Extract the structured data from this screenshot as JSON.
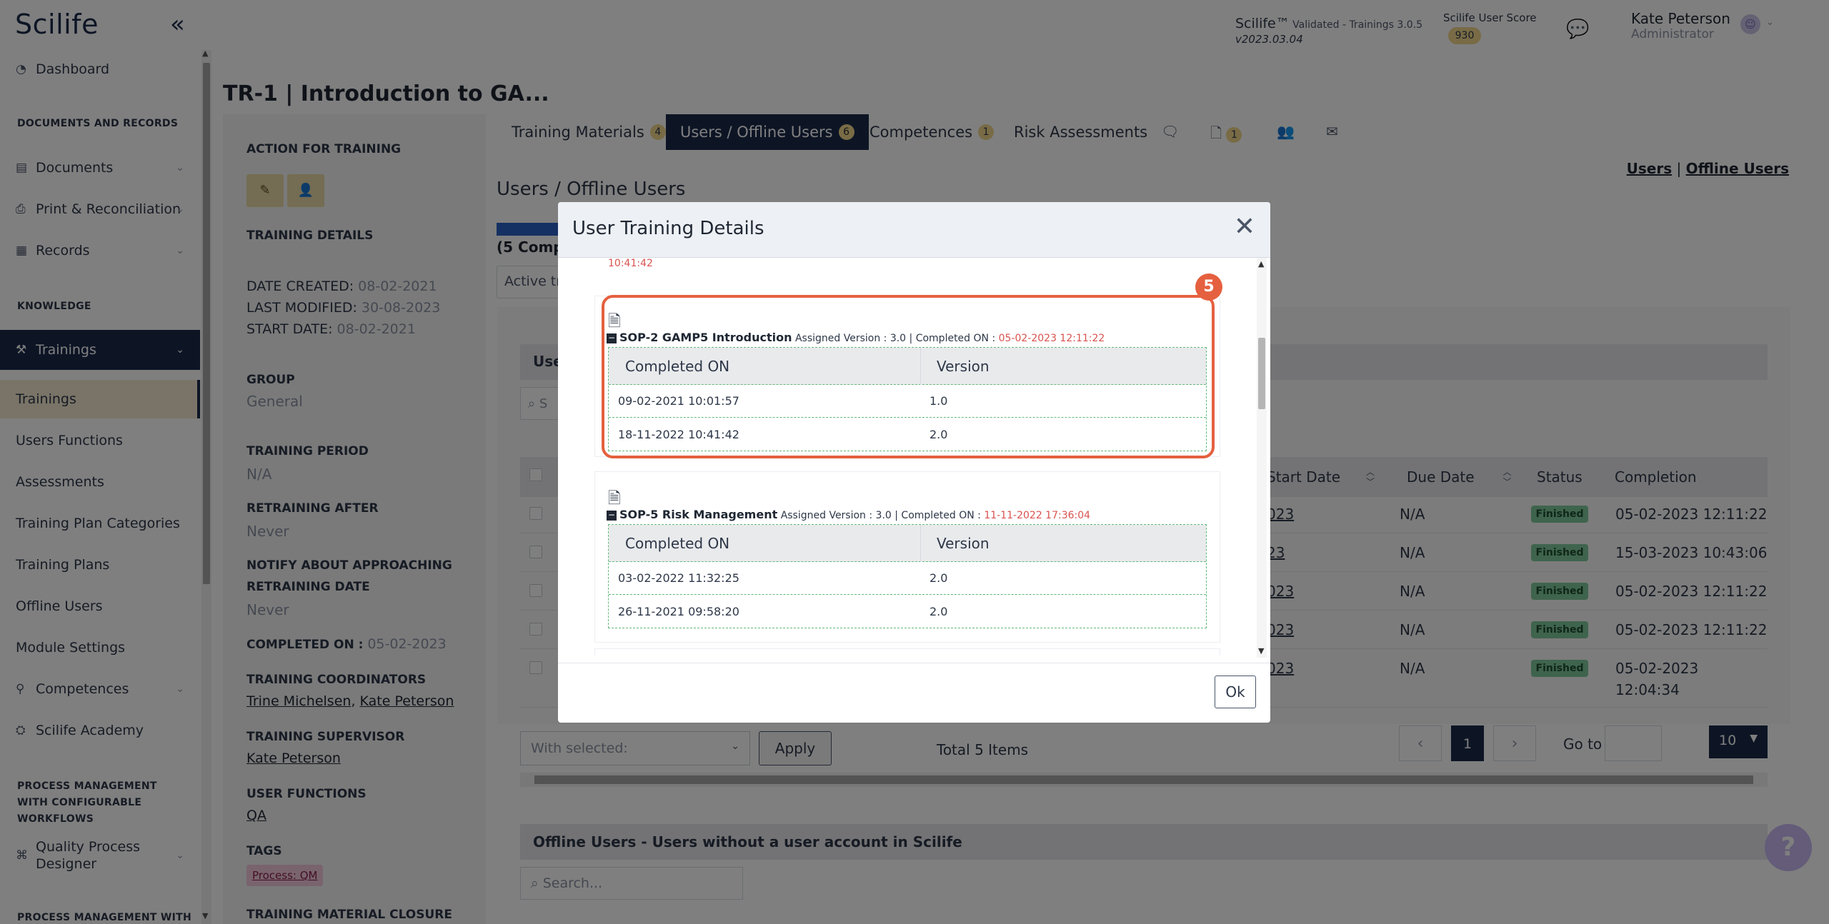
{
  "app": {
    "logo": "Scilife",
    "collapse_icon": "double-chevron-left-icon"
  },
  "header": {
    "version_title": "Scilife™",
    "version_sub": " Validated - Trainings 3.0.5",
    "version_date": "v2023.03.04",
    "score_label": "Scilife User Score",
    "score_value": "930",
    "user_name": "Kate Peterson",
    "user_role": "Administrator"
  },
  "sidebar": {
    "dashboard": "Dashboard",
    "section_docs": "DOCUMENTS AND RECORDS",
    "documents": "Documents",
    "print": "Print & Reconciliation",
    "records": "Records",
    "section_knowledge": "KNOWLEDGE",
    "trainings": "Trainings",
    "sub_trainings": "Trainings",
    "users_functions": "Users Functions",
    "assessments": "Assessments",
    "plan_categories": "Training Plan Categories",
    "plans": "Training Plans",
    "offline_users": "Offline Users",
    "module_settings": "Module Settings",
    "competences": "Competences",
    "academy": "Scilife Academy",
    "section_process": "PROCESS MANAGEMENT WITH CONFIGURABLE WORKFLOWS",
    "quality_designer": "Quality Process Designer",
    "section_process2": "PROCESS MANAGEMENT WITH"
  },
  "page": {
    "title": "TR-1 | Introduction to GA...",
    "action_label": "ACTION FOR TRAINING",
    "details_label": "TRAINING DETAILS",
    "date_created_label": "DATE CREATED: ",
    "date_created": "08-02-2021",
    "last_modified_label": "LAST MODIFIED: ",
    "last_modified": "30-08-2023",
    "start_date_label": "START DATE: ",
    "start_date": "08-02-2021",
    "group_label": "GROUP",
    "group": "General",
    "period_label": "TRAINING PERIOD",
    "period": "N/A",
    "retraining_label": "RETRAINING AFTER",
    "retraining": "Never",
    "notify_label_1": "NOTIFY ABOUT APPROACHING",
    "notify_label_2": "RETRAINING DATE",
    "notify": "Never",
    "completed_label": "COMPLETED ON : ",
    "completed": "05-02-2023",
    "coordinators_label": "TRAINING COORDINATORS",
    "coordinator_1": "Trine Michelsen",
    "coordinator_sep": ", ",
    "coordinator_2": "Kate Peterson",
    "supervisor_label": "TRAINING SUPERVISOR",
    "supervisor": "Kate Peterson",
    "functions_label": "USER FUNCTIONS",
    "functions": "QA",
    "tags_label": "TAGS",
    "tag": "Process: QM",
    "closure_label": "TRAINING MATERIAL CLOSURE"
  },
  "tabs": [
    {
      "label": "Training Materials",
      "badge": "4"
    },
    {
      "label": "Users / Offline Users",
      "badge": "6"
    },
    {
      "label": "Competences",
      "badge": "1"
    },
    {
      "label": "Risk Assessments",
      "badge": ""
    }
  ],
  "tab_icons": {
    "files_badge": "1"
  },
  "content": {
    "title": "Users / Offline Users",
    "link_users": "Users",
    "link_sep": " | ",
    "link_offline": "Offline Users",
    "progress_label": "(5 Compl",
    "progress_pct": 100,
    "active_filter": "Active tr",
    "users_head": "Use",
    "search_placeholder": "S",
    "columns": [
      "Start Date",
      "Due Date",
      "Status",
      "Completion"
    ],
    "rows": [
      {
        "start": "023",
        "due": "N/A",
        "status": "Finished",
        "completion": "05-02-2023 12:11:22"
      },
      {
        "start": "23",
        "due": "N/A",
        "status": "Finished",
        "completion": "15-03-2023 10:43:06"
      },
      {
        "start": "023",
        "due": "N/A",
        "status": "Finished",
        "completion": "05-02-2023 12:11:22"
      },
      {
        "start": "023",
        "due": "N/A",
        "status": "Finished",
        "completion": "05-02-2023 12:11:22"
      },
      {
        "start": "023",
        "due": "N/A",
        "status": "Finished",
        "completion": "05-02-2023",
        "completion2": "12:04:34"
      }
    ],
    "with_selected": "With selected:",
    "apply": "Apply",
    "total": "Total 5 Items",
    "page": "1",
    "goto": "Go to",
    "per_page": "10",
    "offline_head": "Offline Users - Users without a user account in Scilife",
    "offline_search": "Search..."
  },
  "modal": {
    "title": "User Training Details",
    "prev_time": "10:41:42",
    "ok": "Ok",
    "callout_number": "5",
    "items": [
      {
        "name": "SOP-2 GAMP5 Introduction",
        "meta": "Assigned Version : 3.0 | Completed ON : ",
        "completed": "05-02-2023 12:11:22",
        "col_completed": "Completed ON",
        "col_version": "Version",
        "rows": [
          {
            "completed": "09-02-2021 10:01:57",
            "version": "1.0"
          },
          {
            "completed": "18-11-2022 10:41:42",
            "version": "2.0"
          }
        ]
      },
      {
        "name": "SOP-5 Risk Management",
        "meta": "Assigned Version : 3.0 | Completed ON : ",
        "completed": "11-11-2022 17:36:04",
        "col_completed": "Completed ON",
        "col_version": "Version",
        "rows": [
          {
            "completed": "03-02-2022 11:32:25",
            "version": "2.0"
          },
          {
            "completed": "26-11-2021 09:58:20",
            "version": "2.0"
          }
        ]
      }
    ]
  }
}
